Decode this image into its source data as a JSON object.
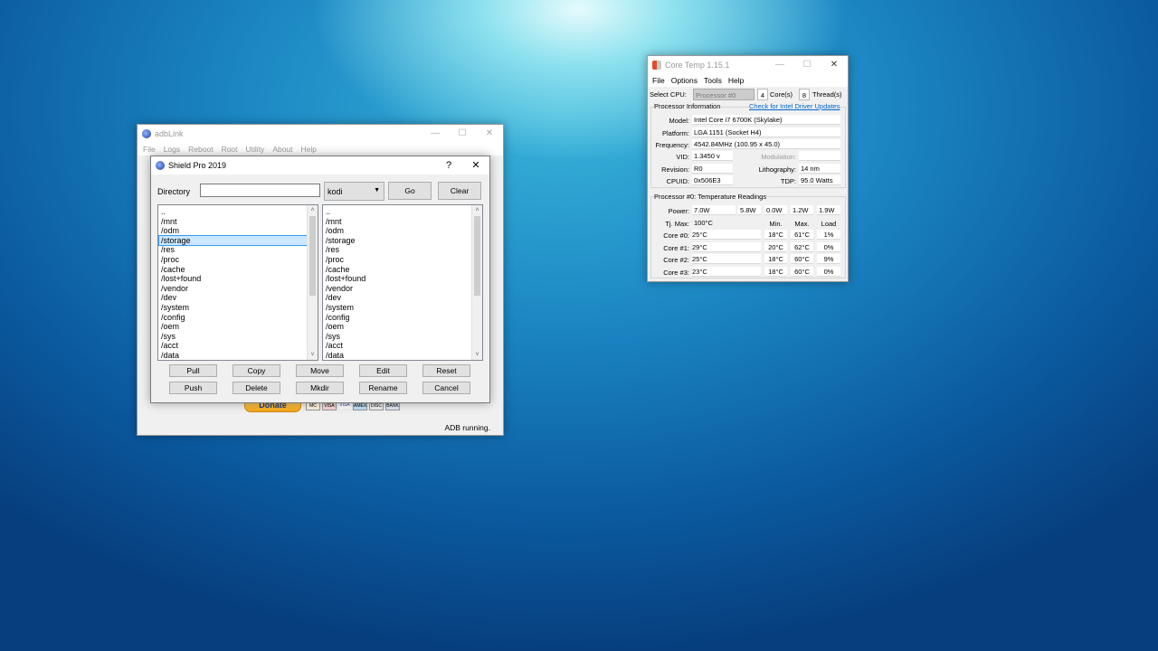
{
  "adblink": {
    "title": "adbLink",
    "menu": [
      "File",
      "Logs",
      "Reboot",
      "Root",
      "Utility",
      "About",
      "Help"
    ],
    "donate_label": "Donate",
    "cards": [
      "MC",
      "VISA",
      "VISA",
      "AMEX",
      "DISC",
      "BANK"
    ],
    "status": "ADB running."
  },
  "shield": {
    "title": "Shield Pro 2019",
    "help_label": "?",
    "close_label": "✕",
    "directory_label": "Directory",
    "directory_value": "",
    "combo_value": "kodi",
    "go_label": "Go",
    "clear_label": "Clear",
    "left_list": [
      "..",
      "/mnt",
      "/odm",
      "/storage",
      "/res",
      "/proc",
      "/cache",
      "/lost+found",
      "/vendor",
      "/dev",
      "/system",
      "/config",
      "/oem",
      "/sys",
      "/acct",
      "/data"
    ],
    "left_selected": 3,
    "right_list": [
      "..",
      "/mnt",
      "/odm",
      "/storage",
      "/res",
      "/proc",
      "/cache",
      "/lost+found",
      "/vendor",
      "/dev",
      "/system",
      "/config",
      "/oem",
      "/sys",
      "/acct",
      "/data"
    ],
    "buttons_row1": [
      "Pull",
      "Copy",
      "Move",
      "Edit",
      "Reset"
    ],
    "buttons_row2": [
      "Push",
      "Delete",
      "Mkdir",
      "Rename",
      "Cancel"
    ]
  },
  "coretemp": {
    "title": "Core Temp 1.15.1",
    "menu": [
      "File",
      "Options",
      "Tools",
      "Help"
    ],
    "select_cpu_label": "Select CPU:",
    "select_cpu_value": "Processor #0",
    "cores_value": "4",
    "cores_label": "Core(s)",
    "threads_value": "8",
    "threads_label": "Thread(s)",
    "proc_info_label": "Processor Information",
    "driver_link": "Check for Intel Driver Updates",
    "model_label": "Model:",
    "model_value": "Intel Core i7 6700K (Skylake)",
    "platform_label": "Platform:",
    "platform_value": "LGA 1151 (Socket H4)",
    "frequency_label": "Frequency:",
    "frequency_value": "4542.84MHz (100.95 x 45.0)",
    "vid_label": "VID:",
    "vid_value": "1.3450 v",
    "modulation_label": "Modulation:",
    "modulation_value": "",
    "revision_label": "Revision:",
    "revision_value": "R0",
    "lithography_label": "Lithography:",
    "lithography_value": "14 nm",
    "cpuid_label": "CPUID:",
    "cpuid_value": "0x506E3",
    "tdp_label": "TDP:",
    "tdp_value": "95.0 Watts",
    "temp_header": "Processor #0: Temperature Readings",
    "power_label": "Power:",
    "power_values": [
      "7.0W",
      "5.8W",
      "0.0W",
      "1.2W",
      "1.9W"
    ],
    "tjmax_label": "Tj. Max:",
    "tjmax_value": "100°C",
    "col_min": "Min.",
    "col_max": "Max.",
    "col_load": "Load",
    "cores": [
      {
        "label": "Core #0:",
        "temp": "25°C",
        "min": "18°C",
        "max": "61°C",
        "load": "1%"
      },
      {
        "label": "Core #1:",
        "temp": "29°C",
        "min": "20°C",
        "max": "62°C",
        "load": "0%"
      },
      {
        "label": "Core #2:",
        "temp": "25°C",
        "min": "18°C",
        "max": "60°C",
        "load": "9%"
      },
      {
        "label": "Core #3:",
        "temp": "23°C",
        "min": "18°C",
        "max": "60°C",
        "load": "0%"
      }
    ]
  }
}
